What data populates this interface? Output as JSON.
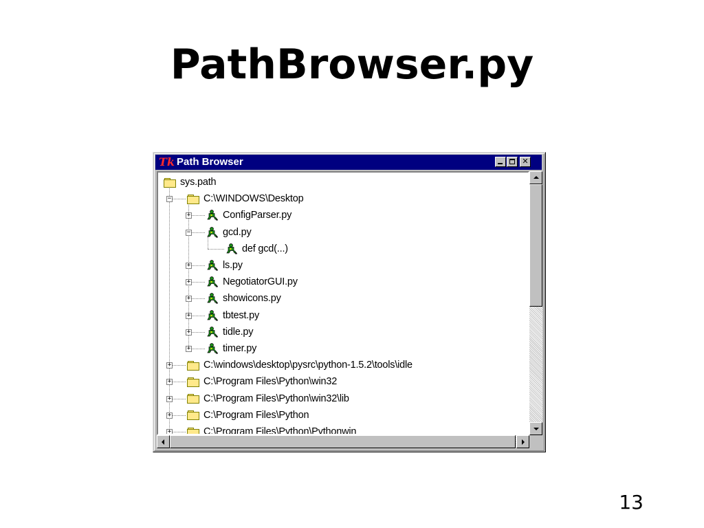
{
  "slide": {
    "title": "PathBrowser.py",
    "page_number": "13"
  },
  "window": {
    "title": "Path Browser",
    "logo_text": "Tk",
    "buttons": [
      "minimize",
      "maximize",
      "close"
    ]
  },
  "tree": {
    "nodes": [
      {
        "label": "sys.path",
        "icon": "folder-icon",
        "toggle": ""
      },
      {
        "label": "C:\\WINDOWS\\Desktop",
        "icon": "folder-icon",
        "toggle": "−"
      },
      {
        "label": "ConfigParser.py",
        "icon": "python-module-icon",
        "toggle": "+"
      },
      {
        "label": "gcd.py",
        "icon": "python-module-icon",
        "toggle": "−"
      },
      {
        "label": "def gcd(...)",
        "icon": "python-module-icon",
        "toggle": ""
      },
      {
        "label": "ls.py",
        "icon": "python-module-icon",
        "toggle": "+"
      },
      {
        "label": "NegotiatorGUI.py",
        "icon": "python-module-icon",
        "toggle": "+"
      },
      {
        "label": "showicons.py",
        "icon": "python-module-icon",
        "toggle": "+"
      },
      {
        "label": "tbtest.py",
        "icon": "python-module-icon",
        "toggle": "+"
      },
      {
        "label": "tidle.py",
        "icon": "python-module-icon",
        "toggle": "+"
      },
      {
        "label": "timer.py",
        "icon": "python-module-icon",
        "toggle": "+"
      },
      {
        "label": "C:\\windows\\desktop\\pysrc\\python-1.5.2\\tools\\idle",
        "icon": "folder-icon",
        "toggle": "+"
      },
      {
        "label": "C:\\Program Files\\Python\\win32",
        "icon": "folder-icon",
        "toggle": "+"
      },
      {
        "label": "C:\\Program Files\\Python\\win32\\lib",
        "icon": "folder-icon",
        "toggle": "+"
      },
      {
        "label": "C:\\Program Files\\Python",
        "icon": "folder-icon",
        "toggle": "+"
      },
      {
        "label": "C:\\Program Files\\Python\\Pythonwin",
        "icon": "folder-icon",
        "toggle": "+"
      }
    ]
  },
  "colors": {
    "titlebar": "#000080",
    "window_face": "#c0c0c0",
    "tk_logo": "#ff2a2a",
    "folder": "#ffe98a",
    "python_icon": "#1a8c1a"
  }
}
